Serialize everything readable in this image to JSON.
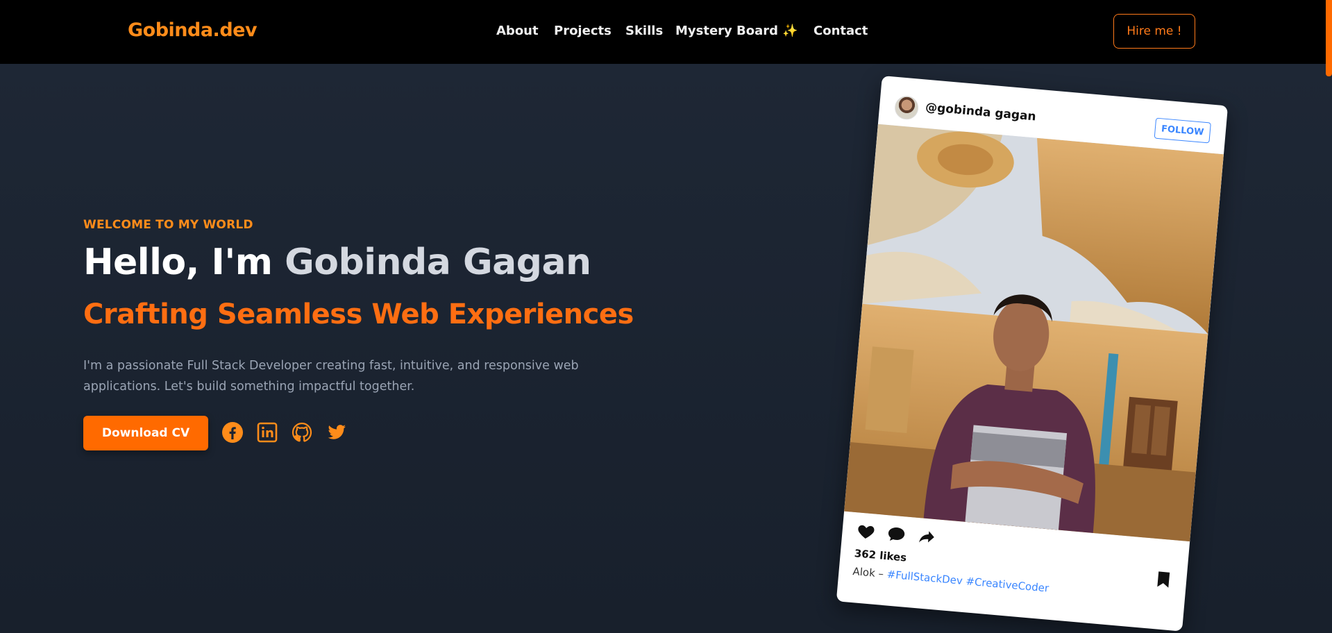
{
  "nav": {
    "logo": "Gobinda.dev",
    "links": [
      "About",
      "Projects",
      "Skills",
      "Mystery Board ✨",
      "Contact"
    ],
    "cta": "Hire me !"
  },
  "hero": {
    "kicker": "WELCOME TO MY WORLD",
    "headline_prefix": "Hello, I'm ",
    "headline_name": "Gobinda Gagan",
    "subhead": "Crafting Seamless Web Experiences",
    "description": "I'm a passionate Full Stack Developer creating fast, intuitive, and responsive web applications. Let's build something impactful together.",
    "cv_button": "Download CV",
    "socials": [
      "facebook-icon",
      "linkedin-icon",
      "github-icon",
      "twitter-icon"
    ]
  },
  "card": {
    "handle": "@gobinda gagan",
    "follow": "FOLLOW",
    "likes": "362 likes",
    "caption_author": "Alok – ",
    "tags": [
      "#FullStackDev",
      "#CreativeCoder"
    ]
  },
  "colors": {
    "accent": "#ff6a00",
    "logo": "#ff8c1a",
    "background": "#1a2230",
    "link_blue": "#3a86ff"
  }
}
